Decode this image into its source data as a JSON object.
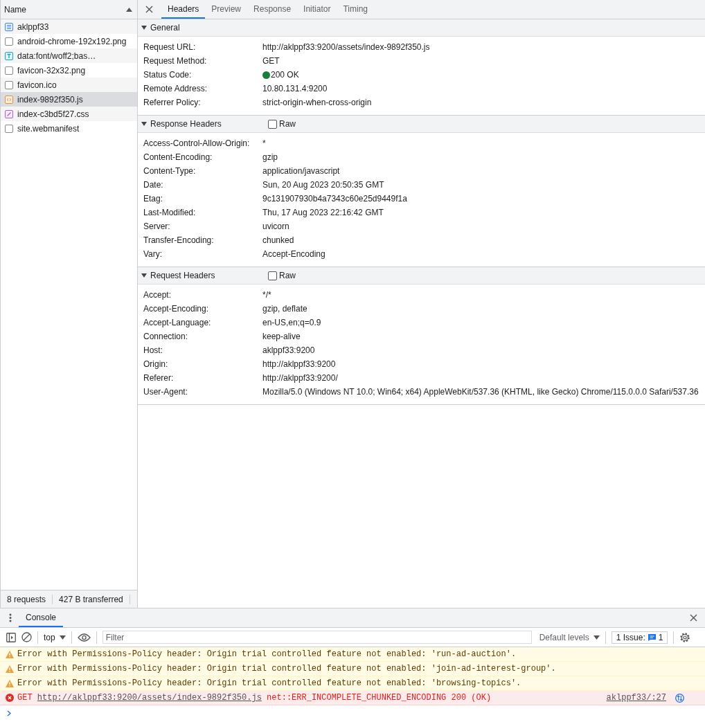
{
  "request_list": {
    "column": "Name",
    "files": [
      {
        "name": "aklppf33",
        "kind": "document",
        "selected": false
      },
      {
        "name": "android-chrome-192x192.png",
        "kind": "blank",
        "selected": false
      },
      {
        "name": "data:font/woff2;bas…",
        "kind": "font",
        "selected": false
      },
      {
        "name": "favicon-32x32.png",
        "kind": "blank",
        "selected": false
      },
      {
        "name": "favicon.ico",
        "kind": "blank",
        "selected": false
      },
      {
        "name": "index-9892f350.js",
        "kind": "script",
        "selected": true
      },
      {
        "name": "index-c3bd5f27.css",
        "kind": "stylesheet",
        "selected": false
      },
      {
        "name": "site.webmanifest",
        "kind": "blank",
        "selected": false
      }
    ],
    "summary": [
      "8 requests",
      "427 B transferred"
    ]
  },
  "tabs": [
    {
      "label": "Headers",
      "selected": true
    },
    {
      "label": "Preview",
      "selected": false
    },
    {
      "label": "Response",
      "selected": false
    },
    {
      "label": "Initiator",
      "selected": false
    },
    {
      "label": "Timing",
      "selected": false
    }
  ],
  "sections": [
    {
      "title": "General",
      "rows": [
        {
          "name": "Request URL:",
          "value": "http://aklppf33:9200/assets/index-9892f350.js"
        },
        {
          "name": "Request Method:",
          "value": "GET"
        },
        {
          "name": "Status Code:",
          "value": "200 OK",
          "kind": "status"
        },
        {
          "name": "Remote Address:",
          "value": "10.80.131.4:9200"
        },
        {
          "name": "Referrer Policy:",
          "value": "strict-origin-when-cross-origin"
        }
      ]
    },
    {
      "title": "Response Headers",
      "raw": {
        "label": "Raw",
        "checked": false
      },
      "rows": [
        {
          "name": "Access-Control-Allow-Origin:",
          "value": "*"
        },
        {
          "name": "Content-Encoding:",
          "value": "gzip"
        },
        {
          "name": "Content-Type:",
          "value": "application/javascript"
        },
        {
          "name": "Date:",
          "value": "Sun, 20 Aug 2023 20:50:35 GMT"
        },
        {
          "name": "Etag:",
          "value": "9c131907930b4a7343c60e25d9449f1a"
        },
        {
          "name": "Last-Modified:",
          "value": "Thu, 17 Aug 2023 22:16:42 GMT"
        },
        {
          "name": "Server:",
          "value": "uvicorn"
        },
        {
          "name": "Transfer-Encoding:",
          "value": "chunked"
        },
        {
          "name": "Vary:",
          "value": "Accept-Encoding"
        }
      ]
    },
    {
      "title": "Request Headers",
      "raw": {
        "label": "Raw",
        "checked": false
      },
      "rows": [
        {
          "name": "Accept:",
          "value": "*/*"
        },
        {
          "name": "Accept-Encoding:",
          "value": "gzip, deflate"
        },
        {
          "name": "Accept-Language:",
          "value": "en-US,en;q=0.9"
        },
        {
          "name": "Connection:",
          "value": "keep-alive"
        },
        {
          "name": "Host:",
          "value": "aklppf33:9200"
        },
        {
          "name": "Origin:",
          "value": "http://aklppf33:9200"
        },
        {
          "name": "Referer:",
          "value": "http://aklppf33:9200/"
        },
        {
          "name": "User-Agent:",
          "value": "Mozilla/5.0 (Windows NT 10.0; Win64; x64) AppleWebKit/537.36 (KHTML, like Gecko) Chrome/115.0.0.0 Safari/537.36"
        }
      ]
    }
  ],
  "drawer": {
    "tab": "Console",
    "context": "top",
    "filter": {
      "placeholder": "Filter"
    },
    "levels": "Default levels",
    "issues": {
      "label": "1 Issue:",
      "count": "1"
    },
    "messages": [
      {
        "kind": "warning",
        "text": "Error with Permissions-Policy header: Origin trial controlled feature not enabled: 'run-ad-auction'."
      },
      {
        "kind": "warning",
        "text": "Error with Permissions-Policy header: Origin trial controlled feature not enabled: 'join-ad-interest-group'."
      },
      {
        "kind": "warning",
        "text": "Error with Permissions-Policy header: Origin trial controlled feature not enabled: 'browsing-topics'."
      },
      {
        "kind": "error",
        "method": "GET",
        "url": "http://aklppf33:9200/assets/index-9892f350.js",
        "text": "net::ERR_INCOMPLETE_CHUNKED_ENCODING 200 (OK)",
        "source": "aklppf33/:27"
      }
    ]
  }
}
